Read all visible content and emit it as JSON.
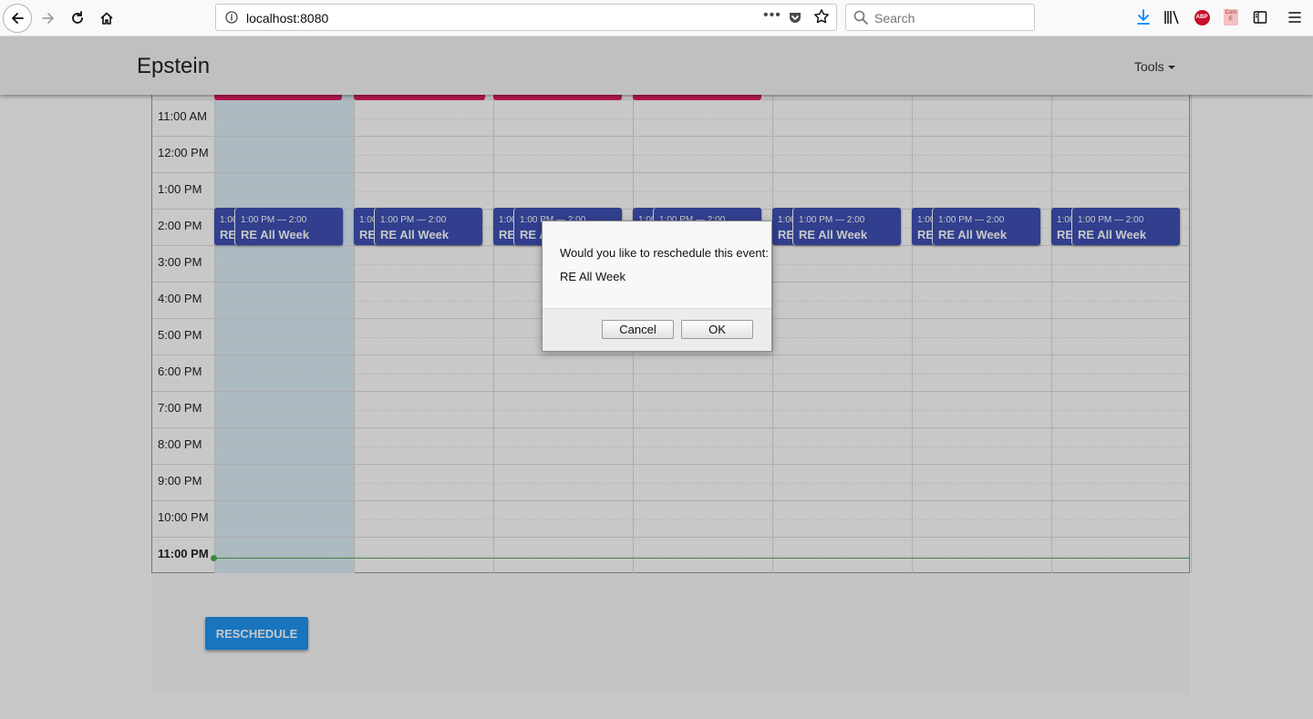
{
  "browser": {
    "url": "localhost:8080",
    "search_placeholder": "Search",
    "abp_label": "ABP",
    "cors_label": "Cors E"
  },
  "app": {
    "brand": "Epstein",
    "tools_label": "Tools"
  },
  "calendar": {
    "hours": [
      "11:00 AM",
      "12:00 PM",
      "1:00 PM",
      "2:00 PM",
      "3:00 PM",
      "4:00 PM",
      "5:00 PM",
      "6:00 PM",
      "7:00 PM",
      "8:00 PM",
      "9:00 PM",
      "10:00 PM",
      "11:00 PM"
    ],
    "events": [
      {
        "back_time": "1:00 PM — 2:00",
        "back_title": "RE All Week",
        "time": "1:00 PM — 2:00",
        "title": "RE All Week"
      },
      {
        "back_time": "1:00 PM — 2:00",
        "back_title": "RE All Week",
        "time": "1:00 PM — 2:00",
        "title": "RE All Week"
      },
      {
        "back_time": "1:00 PM — 2:00",
        "back_title": "RE All Week",
        "time": "1:00 PM — 2:00",
        "title": "RE All Week"
      },
      {
        "back_time": "1:00 PM — 2:00",
        "back_title": "RE All Week",
        "time": "1:00 PM — 2:00",
        "title": "RE All Week"
      },
      {
        "back_time": "1:00 PM — 2:00",
        "back_title": "RE All Week",
        "time": "1:00 PM — 2:00",
        "title": "RE All Week"
      },
      {
        "back_time": "1:00 PM — 2:00",
        "back_title": "RE All Week",
        "time": "1:00 PM — 2:00",
        "title": "RE All Week"
      },
      {
        "back_time": "1:00 PM — 2:00",
        "back_title": "RE All Week",
        "time": "1:00 PM — 2:00",
        "title": "RE All Week"
      }
    ],
    "event_color": "#3f51b5",
    "top_event_color": "#e91e63",
    "now_color": "#4caf50"
  },
  "actions": {
    "reschedule_label": "RESCHEDULE"
  },
  "dialog": {
    "message": "Would you like to reschedule this event:",
    "event_name": "RE All Week",
    "cancel_label": "Cancel",
    "ok_label": "OK"
  }
}
